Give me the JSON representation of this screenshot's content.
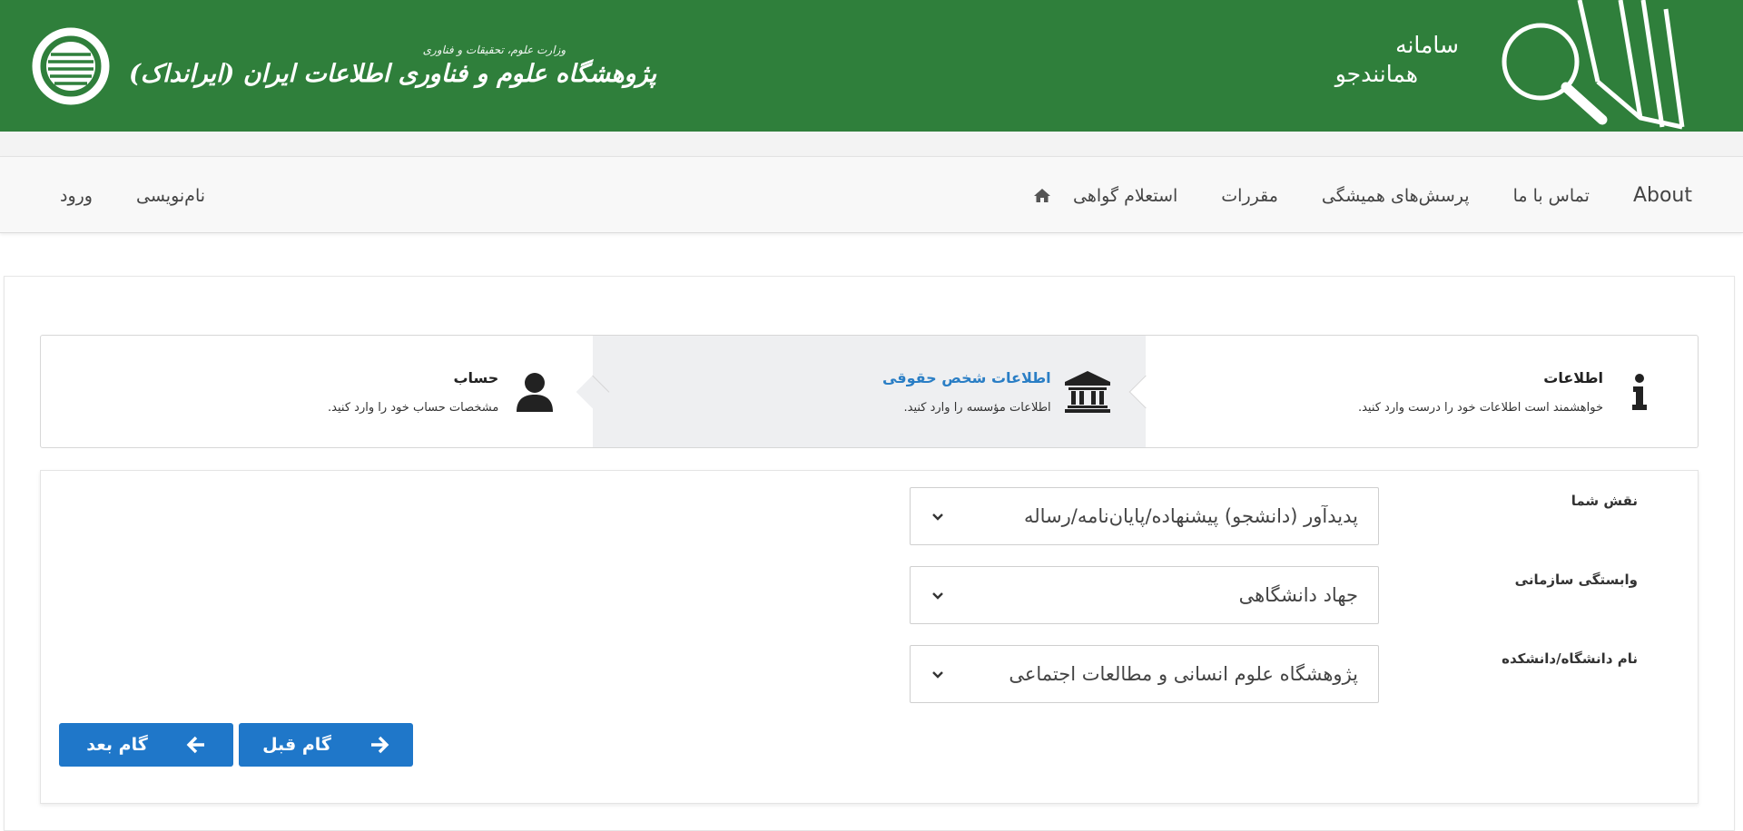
{
  "header": {
    "system_label_line1": "سامانه",
    "system_label_line2": "همانندجو",
    "ministry": "وزارت علوم، تحقیقات و فناوری",
    "institute": "پژوهشگاه علوم و فناوری اطلاعات ایران (ایرانداک)",
    "color": "#2f7f3b"
  },
  "nav": {
    "items": [
      {
        "label": "استعلام گواهی"
      },
      {
        "label": "مقررات"
      },
      {
        "label": "پرسش‌های همیشگی"
      },
      {
        "label": "تماس با ما"
      },
      {
        "label": "About"
      }
    ],
    "auth": {
      "login": "ورود",
      "register": "نام‌نویسی"
    },
    "home_icon": "home-icon"
  },
  "steps": [
    {
      "title": "اطلاعات",
      "desc": "خواهشمند است اطلاعات خود را درست وارد کنید.",
      "icon": "info-icon"
    },
    {
      "title": "اطلاعات شخص حقوقی",
      "desc": "اطلاعات مؤسسه را وارد کنید.",
      "icon": "institution-icon",
      "active": true
    },
    {
      "title": "حساب",
      "desc": "مشخصات حساب خود را  وارد کنید.",
      "icon": "user-icon"
    }
  ],
  "form": {
    "role": {
      "label": "نقش شما",
      "value": "پدیدآور (دانشجو) پیشنهاده/پایان‌نامه/رساله"
    },
    "affiliation": {
      "label": "وابستگی سازمانی",
      "value": "جهاد دانشگاهی"
    },
    "university": {
      "label": "نام دانشگاه/دانشکده",
      "value": "پژوهشگاه علوم انسانی و مطالعات اجتماعی"
    }
  },
  "buttons": {
    "prev": "گام قبل",
    "next": "گام بعد",
    "color": "#1f77c9"
  },
  "accent": "#2a7ec5"
}
